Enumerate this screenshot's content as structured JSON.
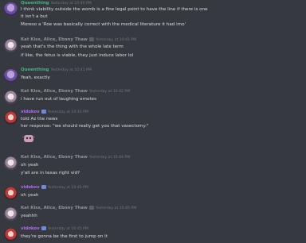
{
  "messages": [
    {
      "author": "Queenthing",
      "avatar": "queenthing-avatar",
      "name_color": "#43b581",
      "timestamp": "Yesterday at 10:40 PM",
      "lines": [
        "I think viability outside the womb is a fine legal point to have the line if there is one",
        "it isn't a but",
        "Moreso a 'Roe was basically correct with the medical literature it had imo'"
      ]
    },
    {
      "author": "Kat Kiss, Alice, Ebony Thaw",
      "avatar": "kat-avatar",
      "name_color": "#8e9297",
      "timestamp": "Yesterday at 10:41 PM",
      "lines": [
        "yeah that's the thing with the whole late term",
        "if like, the fetus is viable, they just induce labor lol"
      ]
    },
    {
      "author": "Queenthing",
      "avatar": "queenthing-avatar",
      "name_color": "#43b581",
      "timestamp": "Yesterday at 10:41 PM",
      "lines": [
        "Yeah, exactly"
      ]
    },
    {
      "author": "Kat Kiss, Alice, Ebony Thaw",
      "avatar": "kat-avatar",
      "name_color": "#8e9297",
      "timestamp": "Yesterday at 10:42 PM",
      "lines": [
        "i have run out of laughing emotes"
      ]
    },
    {
      "author": "vidokov",
      "avatar": "vidokov-avatar",
      "name_color": "#b06cf2",
      "timestamp": "Yesterday at 10:43 PM",
      "lines": [
        "told Az the news",
        "her response: \"we should really get you that vasectomy.\""
      ]
    },
    {
      "author": "Kat Kiss, Alice, Ebony Thaw",
      "avatar": "kat-avatar",
      "name_color": "#8e9297",
      "timestamp": "Yesterday at 10:44 PM",
      "lines": [
        "oh yeah",
        "y'all are in texas right vid?"
      ]
    },
    {
      "author": "vidokov",
      "avatar": "vidokov-avatar",
      "name_color": "#b06cf2",
      "timestamp": "Yesterday at 10:45 PM",
      "lines": [
        "oh yeah"
      ]
    },
    {
      "author": "Kat Kiss, Alice, Ebony Thaw",
      "avatar": "kat-avatar",
      "name_color": "#8e9297",
      "timestamp": "Yesterday at 10:45 PM",
      "lines": [
        "yeahhh"
      ]
    },
    {
      "author": "vidokov",
      "avatar": "vidokov-avatar",
      "name_color": "#b06cf2",
      "timestamp": "Yesterday at 10:45 PM",
      "lines": [
        "they're gonna be the first to jump on it"
      ]
    }
  ]
}
